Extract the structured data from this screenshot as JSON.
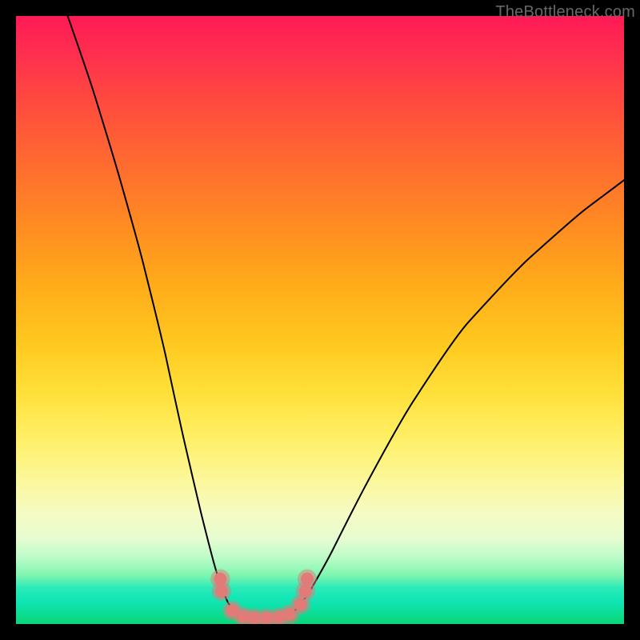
{
  "watermark": "TheBottleneck.com",
  "chart_data": {
    "type": "line",
    "title": "",
    "xlabel": "",
    "ylabel": "",
    "x_range": [
      0,
      100
    ],
    "y_range": [
      0,
      100
    ],
    "curve_left": {
      "comment": "Descending branch from top-left toward minimum",
      "points": [
        {
          "x": 8.5,
          "y": 100
        },
        {
          "x": 12,
          "y": 90
        },
        {
          "x": 16,
          "y": 77
        },
        {
          "x": 20,
          "y": 63
        },
        {
          "x": 24,
          "y": 47
        },
        {
          "x": 27,
          "y": 33
        },
        {
          "x": 30,
          "y": 20
        },
        {
          "x": 32.5,
          "y": 10
        },
        {
          "x": 34.5,
          "y": 4
        },
        {
          "x": 36.5,
          "y": 1.3
        }
      ]
    },
    "curve_bottom": {
      "comment": "Flat minimum segment hugging the bottom",
      "points": [
        {
          "x": 36.5,
          "y": 1.3
        },
        {
          "x": 39,
          "y": 0.9
        },
        {
          "x": 42,
          "y": 0.9
        },
        {
          "x": 45,
          "y": 1.3
        }
      ]
    },
    "curve_right": {
      "comment": "Ascending branch from minimum toward upper-right",
      "points": [
        {
          "x": 45,
          "y": 1.3
        },
        {
          "x": 47.5,
          "y": 4
        },
        {
          "x": 51,
          "y": 10
        },
        {
          "x": 56,
          "y": 20
        },
        {
          "x": 63,
          "y": 33
        },
        {
          "x": 72,
          "y": 47
        },
        {
          "x": 82,
          "y": 58
        },
        {
          "x": 92,
          "y": 67
        },
        {
          "x": 100,
          "y": 73
        }
      ]
    },
    "markers": {
      "comment": "Salmon dot markers clustered near the curve minimum",
      "color": "#e27a78",
      "radius_outer": 1.6,
      "radius_inner": 1.05,
      "points": [
        {
          "x": 33.6,
          "y": 7.4
        },
        {
          "x": 33.8,
          "y": 5.4
        },
        {
          "x": 35.6,
          "y": 2.2
        },
        {
          "x": 37.4,
          "y": 1.2
        },
        {
          "x": 39.2,
          "y": 0.95
        },
        {
          "x": 41.2,
          "y": 0.95
        },
        {
          "x": 43.2,
          "y": 1.05
        },
        {
          "x": 45.0,
          "y": 1.6
        },
        {
          "x": 46.8,
          "y": 3.2
        },
        {
          "x": 47.6,
          "y": 5.4
        },
        {
          "x": 47.9,
          "y": 7.4
        }
      ]
    }
  }
}
